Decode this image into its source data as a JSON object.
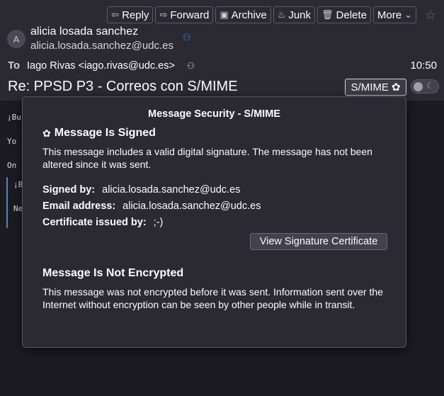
{
  "toolbar": {
    "reply": "Reply",
    "forward": "Forward",
    "archive": "Archive",
    "junk": "Junk",
    "delete": "Delete",
    "more": "More"
  },
  "header": {
    "avatar_initial": "A",
    "from_name": "alicia losada sanchez",
    "from_address": "alicia.losada.sanchez@udc.es",
    "to_label": "To",
    "to_value": "Iago Rivas <iago.rivas@udc.es>",
    "time": "10:50",
    "subject": "Re: PPSD P3 - Correos con S/MIME",
    "smime_label": "S/MIME"
  },
  "body_lines": [
    "¡Bu",
    "Yo",
    "On",
    "¡B",
    "Ne"
  ],
  "popup": {
    "title": "Message Security - S/MIME",
    "signed_heading": "Message Is Signed",
    "signed_text": "This message includes a valid digital signature. The message has not been altered since it was sent.",
    "signed_by_label": "Signed by:",
    "signed_by_value": "alicia.losada.sanchez@udc.es",
    "email_label": "Email address:",
    "email_value": "alicia.losada.sanchez@udc.es",
    "issuer_label": "Certificate issued by:",
    "issuer_value": ";-)",
    "view_cert_button": "View Signature Certificate",
    "encrypted_heading": "Message Is Not Encrypted",
    "encrypted_text": "This message was not encrypted before it was sent. Information sent over the Internet without encryption can be seen by other people while in transit."
  },
  "icons": {
    "reply": "reply-arrow-icon",
    "forward": "forward-arrow-icon",
    "archive": "archive-box-icon",
    "junk": "flame-icon",
    "delete": "trash-icon",
    "more": "chevron-down-icon",
    "star": "star-icon",
    "signed": "rosette-icon"
  },
  "colors": {
    "background": "#1c1b22",
    "header_bg": "#2b2a33",
    "accent": "#3b8cf0",
    "quote_bar": "#4a85c8"
  }
}
